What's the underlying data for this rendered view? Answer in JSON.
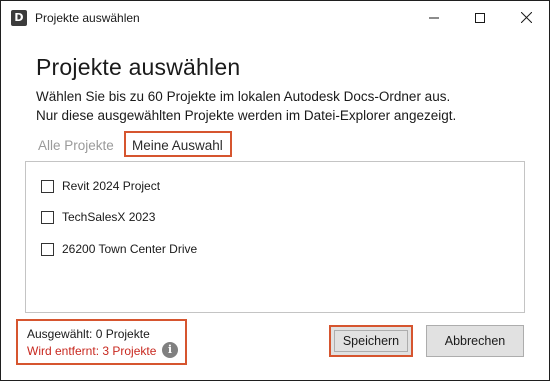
{
  "window": {
    "title": "Projekte auswählen",
    "app_icon_letter": "D"
  },
  "dialog": {
    "heading": "Projekte auswählen",
    "description_line1": "Wählen Sie bis zu 60 Projekte im lokalen Autodesk Docs-Ordner aus.",
    "description_line2": "Nur diese ausgewählten Projekte werden im Datei-Explorer angezeigt."
  },
  "tabs": {
    "all": "Alle Projekte",
    "mine": "Meine Auswahl",
    "active": "mine"
  },
  "projects": [
    {
      "name": "Revit 2024 Project",
      "checked": false
    },
    {
      "name": "TechSalesX 2023",
      "checked": false
    },
    {
      "name": "26200 Town Center Drive",
      "checked": false
    }
  ],
  "status": {
    "selected": "Ausgewählt: 0 Projekte",
    "removed": "Wird entfernt: 3 Projekte"
  },
  "buttons": {
    "save": "Speichern",
    "cancel": "Abbrechen"
  },
  "colors": {
    "highlight": "#d6552f",
    "warning_text": "#c8281f"
  }
}
